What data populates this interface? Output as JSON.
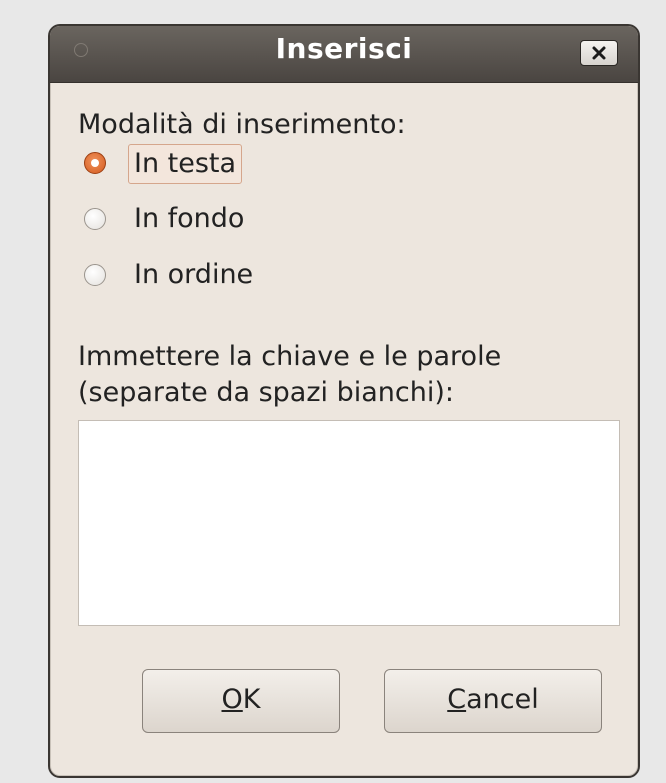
{
  "dialog": {
    "title": "Inserisci",
    "mode_label": "Modalità di inserimento:",
    "options": [
      {
        "label": "In testa",
        "selected": true
      },
      {
        "label": "In fondo",
        "selected": false
      },
      {
        "label": "In ordine",
        "selected": false
      }
    ],
    "input_label_line1": "Immettere la chiave e le parole",
    "input_label_line2": "(separate da spazi bianchi):",
    "input_value": "",
    "ok_button": {
      "mnemonic": "O",
      "rest": "K"
    },
    "cancel_button": {
      "mnemonic": "C",
      "rest": "ancel"
    }
  },
  "icons": {
    "window_menu": "circle-icon",
    "close": "close-icon"
  },
  "colors": {
    "titlebar": "#4a4541",
    "window_bg": "#ede6de",
    "radio_selected": "#d45a1e"
  }
}
